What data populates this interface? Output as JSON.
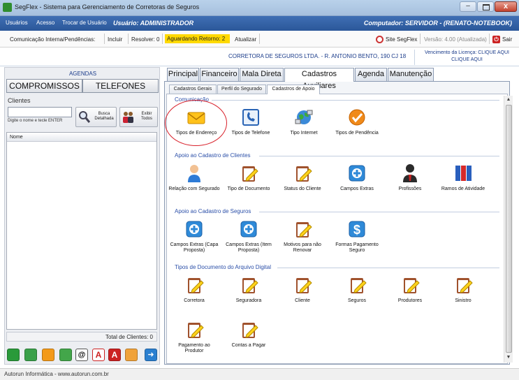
{
  "window": {
    "title": "SegFlex - Sistema para Gerenciamento de Corretoras de Seguros",
    "close": "x",
    "minimize": "–"
  },
  "menu": {
    "items": [
      "Usuários",
      "Acesso",
      "Trocar de Usuário"
    ],
    "user": "Usuário: ADMINISTRADOR",
    "computer": "Computador: SERVIDOR - (RENATO-NOTEBOOK)"
  },
  "toolbar": {
    "comunicacao": "Comunicação Interna/Pendências:",
    "incluir": "Incluir",
    "resolver": "Resolver: 0",
    "aguardando": "Aguardando Retorno: 2",
    "atualizar": "Atualizar",
    "site": "Site SegFlex",
    "versao": "Versão: 4.00 (Atualizada)",
    "sair": "Sair"
  },
  "info": {
    "company": "CORRETORA DE SEGUROS LTDA. - R. ANTONIO BENTO, 190 CJ 18",
    "licenca_1": "Vencimento da Licença: CLIQUE AQUI",
    "licenca_2": "CLIQUE AQUI"
  },
  "left": {
    "agendas": "AGENDAS",
    "compromissos": "COMPROMISSOS",
    "telefones": "TELEFONES",
    "clientes": "Clientes",
    "hint": "Digite o nome e tecle ENTER",
    "busca": "Busca Detalhada",
    "exibir": "Exibir Todos",
    "grid_header": "Nome",
    "total": "Total de Clientes: 0"
  },
  "tabs": [
    "Principal",
    "Financeiro",
    "Mala Direta",
    "Cadastros Auxiliares",
    "Agenda",
    "Manutenção"
  ],
  "subtabs": [
    "Cadastros Gerais",
    "Perfil do Segurado",
    "Cadastros de Apoio"
  ],
  "sections": [
    {
      "title": "Comunicação",
      "items": [
        "Tipos de Endereço",
        "Tipos de Telefone",
        "Tipo Internet",
        "Tipos de Pendência"
      ]
    },
    {
      "title": "Apoio ao Cadastro de Clientes",
      "items": [
        "Relação com Segurado",
        "Tipo de Documento",
        "Status do Cliente",
        "Campos Extras",
        "Profissões",
        "Ramos de Atividade"
      ]
    },
    {
      "title": "Apoio ao Cadastro de Seguros",
      "items": [
        "Campos Extras (Capa Proposta)",
        "Campos Extras (Item Proposta)",
        "Motivos para não Renovar",
        "Formas Pagamento Seguro"
      ]
    },
    {
      "title": "Tipos de Documento do Arquivo Digital",
      "items": [
        "Corretora",
        "Seguradora",
        "Cliente",
        "Seguros",
        "Produtores",
        "Sinistro",
        "Pagamento ao Produtor",
        "Contas a Pagar"
      ]
    }
  ],
  "status": "Autorun Informática - www.autorun.com.br",
  "colors": {
    "menubar": "#2f5fa6",
    "highlight": "#ffd900",
    "section": "#2b4fa8",
    "circle": "#d8202a"
  }
}
